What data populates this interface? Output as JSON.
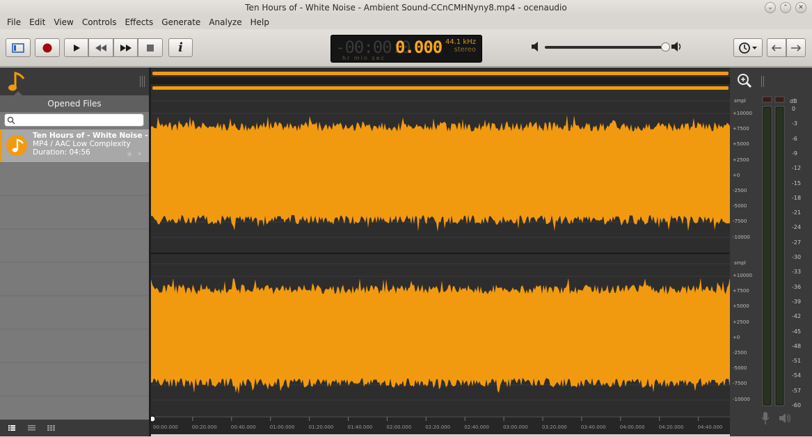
{
  "window": {
    "title": "Ten Hours of  - White Noise - Ambient Sound-CCnCMHNyny8.mp4 - ocenaudio"
  },
  "menu": [
    "File",
    "Edit",
    "View",
    "Controls",
    "Effects",
    "Generate",
    "Analyze",
    "Help"
  ],
  "display": {
    "dim_digits": "-00:00:0",
    "time": "0.000",
    "units": "hr   min  sec",
    "sample_rate": "44.1 kHz",
    "channels": "stereo"
  },
  "sidebar": {
    "header": "Opened Files",
    "search_placeholder": "",
    "file": {
      "name": "Ten Hours of  - White Noise - ...",
      "format": "MP4 / AAC Low Complexity",
      "duration": "Duration: 04:56"
    }
  },
  "waveform": {
    "unit": "smpl",
    "scale_labels": [
      "+10000",
      "+7500",
      "+5000",
      "+2500",
      "+0",
      "-2500",
      "-5000",
      "-7500",
      "-10000"
    ],
    "time_labels": [
      "00:00.000",
      "00:20.000",
      "00:40.000",
      "01:00.000",
      "01:20.000",
      "01:40.000",
      "02:00.000",
      "02:20.000",
      "02:40.000",
      "03:00.000",
      "03:20.000",
      "03:40.000",
      "04:00.000",
      "04:20.000",
      "04:40.000"
    ],
    "color": "#f29a0f"
  },
  "meter": {
    "unit": "dB",
    "labels": [
      "0",
      "-3",
      "-6",
      "-9",
      "-12",
      "-15",
      "-18",
      "-21",
      "-24",
      "-27",
      "-30",
      "-33",
      "-36",
      "-39",
      "-42",
      "-45",
      "-48",
      "-51",
      "-54",
      "-57",
      "-60"
    ]
  },
  "colors": {
    "accent": "#f29a0f",
    "background": "#262626"
  }
}
